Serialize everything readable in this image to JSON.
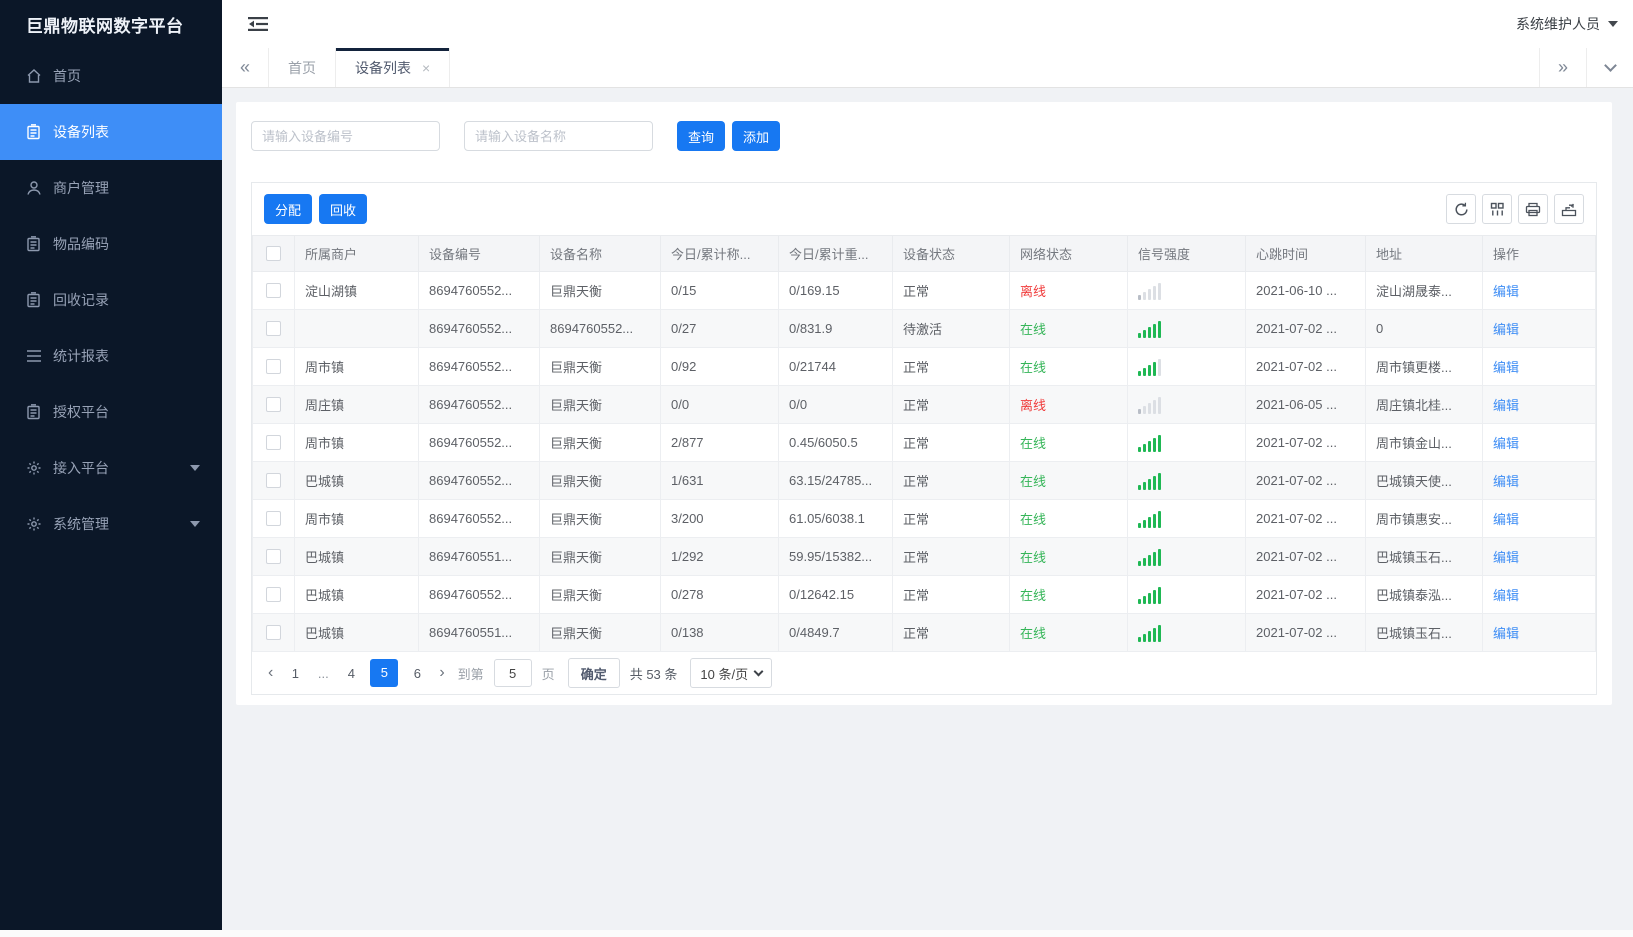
{
  "app": {
    "logo_title": "巨鼎物联网数字平台",
    "user_name": "系统维护人员"
  },
  "icons": {
    "scroll_left": "«",
    "scroll_right": "»",
    "close": "×",
    "prev": "‹",
    "next": "›"
  },
  "sidebar": {
    "items": [
      {
        "label": "首页"
      },
      {
        "label": "设备列表"
      },
      {
        "label": "商户管理"
      },
      {
        "label": "物品编码"
      },
      {
        "label": "回收记录"
      },
      {
        "label": "统计报表"
      },
      {
        "label": "授权平台"
      },
      {
        "label": "接入平台"
      },
      {
        "label": "系统管理"
      }
    ]
  },
  "tabbar": {
    "tabs": [
      {
        "label": "首页"
      },
      {
        "label": "设备列表"
      }
    ]
  },
  "search": {
    "device_no_placeholder": "请输入设备编号",
    "device_name_placeholder": "请输入设备名称",
    "query_label": "查询",
    "add_label": "添加"
  },
  "toolbar": {
    "assign_label": "分配",
    "recycle_label": "回收"
  },
  "table": {
    "columns": [
      "所属商户",
      "设备编号",
      "设备名称",
      "今日/累计称...",
      "今日/累计重...",
      "设备状态",
      "网络状态",
      "信号强度",
      "心跳时间",
      "地址",
      "操作"
    ],
    "rows": [
      {
        "merchant": "淀山湖镇",
        "device_no": "8694760552...",
        "device_name": "巨鼎天衡",
        "today_count": "0/15",
        "today_weight": "0/169.15",
        "device_status": "正常",
        "net_status": "离线",
        "net_state": "offline",
        "signal": "gray",
        "heartbeat": "2021-06-10 ...",
        "address": "淀山湖晟泰...",
        "action": "编辑"
      },
      {
        "merchant": "",
        "device_no": "8694760552...",
        "device_name": "8694760552...",
        "today_count": "0/27",
        "today_weight": "0/831.9",
        "device_status": "待激活",
        "net_status": "在线",
        "net_state": "online",
        "signal": "green",
        "heartbeat": "2021-07-02 ...",
        "address": "0",
        "action": "编辑"
      },
      {
        "merchant": "周市镇",
        "device_no": "8694760552...",
        "device_name": "巨鼎天衡",
        "today_count": "0/92",
        "today_weight": "0/21744",
        "device_status": "正常",
        "net_status": "在线",
        "net_state": "online",
        "signal": "green4",
        "heartbeat": "2021-07-02 ...",
        "address": "周市镇更楼...",
        "action": "编辑"
      },
      {
        "merchant": "周庄镇",
        "device_no": "8694760552...",
        "device_name": "巨鼎天衡",
        "today_count": "0/0",
        "today_weight": "0/0",
        "device_status": "正常",
        "net_status": "离线",
        "net_state": "offline",
        "signal": "gray",
        "heartbeat": "2021-06-05 ...",
        "address": "周庄镇北桂...",
        "action": "编辑"
      },
      {
        "merchant": "周市镇",
        "device_no": "8694760552...",
        "device_name": "巨鼎天衡",
        "today_count": "2/877",
        "today_weight": "0.45/6050.5",
        "device_status": "正常",
        "net_status": "在线",
        "net_state": "online",
        "signal": "green",
        "heartbeat": "2021-07-02 ...",
        "address": "周市镇金山...",
        "action": "编辑"
      },
      {
        "merchant": "巴城镇",
        "device_no": "8694760552...",
        "device_name": "巨鼎天衡",
        "today_count": "1/631",
        "today_weight": "63.15/24785...",
        "device_status": "正常",
        "net_status": "在线",
        "net_state": "online",
        "signal": "green",
        "heartbeat": "2021-07-02 ...",
        "address": "巴城镇天使...",
        "action": "编辑"
      },
      {
        "merchant": "周市镇",
        "device_no": "8694760552...",
        "device_name": "巨鼎天衡",
        "today_count": "3/200",
        "today_weight": "61.05/6038.1",
        "device_status": "正常",
        "net_status": "在线",
        "net_state": "online",
        "signal": "green",
        "heartbeat": "2021-07-02 ...",
        "address": "周市镇惠安...",
        "action": "编辑"
      },
      {
        "merchant": "巴城镇",
        "device_no": "8694760551...",
        "device_name": "巨鼎天衡",
        "today_count": "1/292",
        "today_weight": "59.95/15382...",
        "device_status": "正常",
        "net_status": "在线",
        "net_state": "online",
        "signal": "green",
        "heartbeat": "2021-07-02 ...",
        "address": "巴城镇玉石...",
        "action": "编辑"
      },
      {
        "merchant": "巴城镇",
        "device_no": "8694760552...",
        "device_name": "巨鼎天衡",
        "today_count": "0/278",
        "today_weight": "0/12642.15",
        "device_status": "正常",
        "net_status": "在线",
        "net_state": "online",
        "signal": "green",
        "heartbeat": "2021-07-02 ...",
        "address": "巴城镇泰泓...",
        "action": "编辑"
      },
      {
        "merchant": "巴城镇",
        "device_no": "8694760551...",
        "device_name": "巨鼎天衡",
        "today_count": "0/138",
        "today_weight": "0/4849.7",
        "device_status": "正常",
        "net_status": "在线",
        "net_state": "online",
        "signal": "green",
        "heartbeat": "2021-07-02 ...",
        "address": "巴城镇玉石...",
        "action": "编辑"
      }
    ]
  },
  "pagination": {
    "pages": [
      "1",
      "...",
      "4",
      "5",
      "6"
    ],
    "active_page": "5",
    "goto_label": "到第",
    "goto_value": "5",
    "unit_label": "页",
    "confirm_label": "确定",
    "total_label": "共 53 条",
    "page_size_label": "10 条/页"
  },
  "colors": {
    "sidebar_bg": "#0b1728",
    "sidebar_active": "#3e8ef7",
    "accent_blue": "#1778f2",
    "online_green": "#35b558",
    "offline_red": "#f03b3b",
    "link_blue": "#3f8ef5",
    "signal_green": "#1fb854",
    "signal_gray": "#dcdfe4"
  }
}
